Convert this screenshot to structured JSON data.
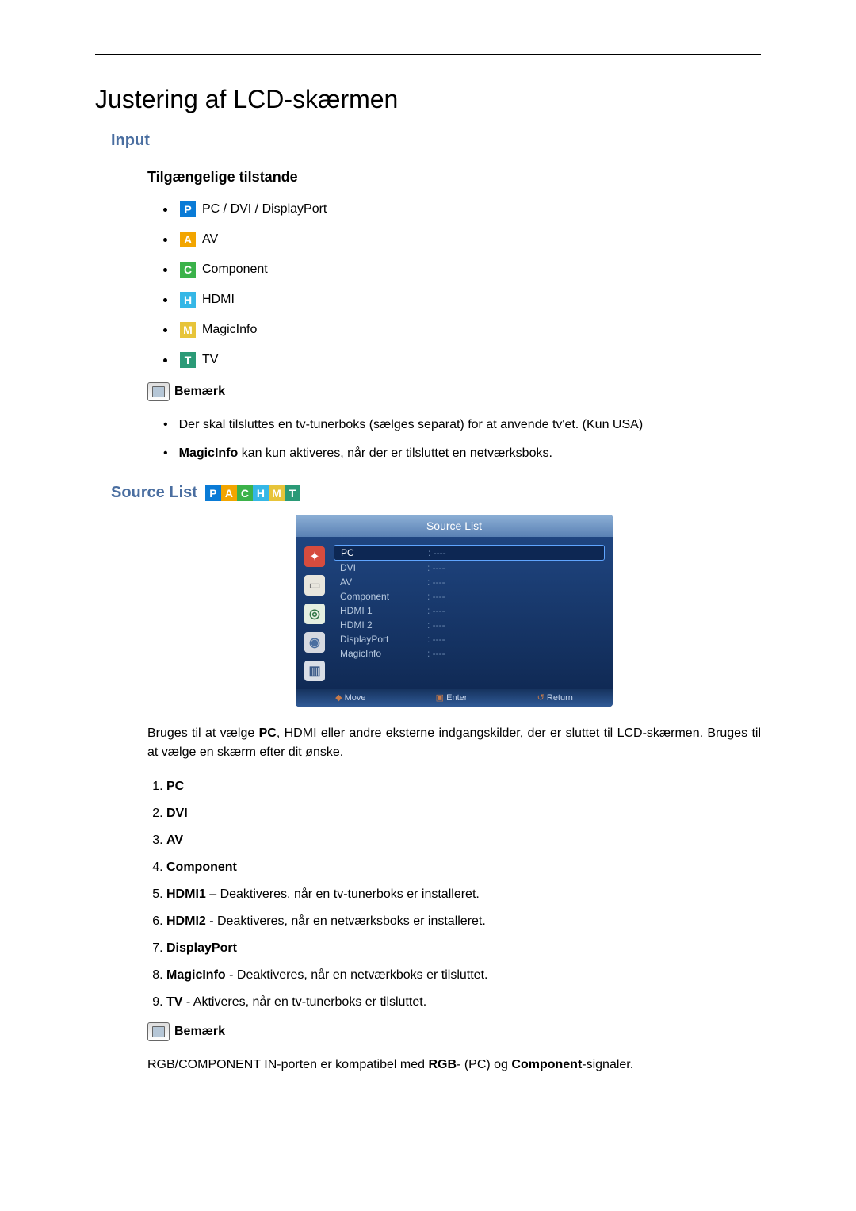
{
  "title": "Justering af LCD-skærmen",
  "section_input": "Input",
  "modes_heading": "Tilgængelige tilstande",
  "modes": {
    "p": "P",
    "p_label": "PC / DVI / DisplayPort",
    "a": "A",
    "a_label": "AV",
    "c": "C",
    "c_label": "Component",
    "h": "H",
    "h_label": "HDMI",
    "m": "M",
    "m_label": "MagicInfo",
    "t": "T",
    "t_label": "TV"
  },
  "note_label": "Bemærk",
  "note_items": {
    "n1": "Der skal tilsluttes en tv-tunerboks (sælges separat) for at anvende tv'et. (Kun USA)",
    "n2_bold": "MagicInfo",
    "n2_rest": " kan kun aktiveres, når der er tilsluttet en netværksboks."
  },
  "source_list_label": "Source List",
  "osd": {
    "title": "Source List",
    "rows": [
      {
        "name": "PC",
        "val": ": ----",
        "sel": true
      },
      {
        "name": "DVI",
        "val": ": ----"
      },
      {
        "name": "AV",
        "val": ": ----"
      },
      {
        "name": "Component",
        "val": ": ----"
      },
      {
        "name": "HDMI 1",
        "val": ": ----"
      },
      {
        "name": "HDMI 2",
        "val": ": ----"
      },
      {
        "name": "DisplayPort",
        "val": ": ----"
      },
      {
        "name": "MagicInfo",
        "val": ": ----"
      }
    ],
    "foot": {
      "move": "Move",
      "enter": "Enter",
      "return": "Return"
    }
  },
  "source_desc_pre": "Bruges til at vælge ",
  "source_desc_bold": "PC",
  "source_desc_post": ", HDMI eller andre eksterne indgangskilder, der er sluttet til LCD-skærmen. Bruges til at vælge en skærm efter dit ønske.",
  "numbered": {
    "i1": "PC",
    "i2": "DVI",
    "i3": "AV",
    "i4": "Component",
    "i5_b": "HDMI1",
    "i5_r": " ‒ Deaktiveres, når en tv-tunerboks er installeret.",
    "i6_b": "HDMI2",
    "i6_r": " - Deaktiveres, når en netværksboks er installeret.",
    "i7": "DisplayPort",
    "i8_b": "MagicInfo",
    "i8_r": " - Deaktiveres, når en netværkboks er tilsluttet.",
    "i9_b": "TV",
    "i9_r": " - Aktiveres, når en tv-tunerboks er tilsluttet."
  },
  "note2_pre": "RGB/COMPONENT IN-porten er kompatibel med ",
  "note2_b1": "RGB",
  "note2_mid": "- (PC) og ",
  "note2_b2": "Component",
  "note2_post": "-signaler."
}
